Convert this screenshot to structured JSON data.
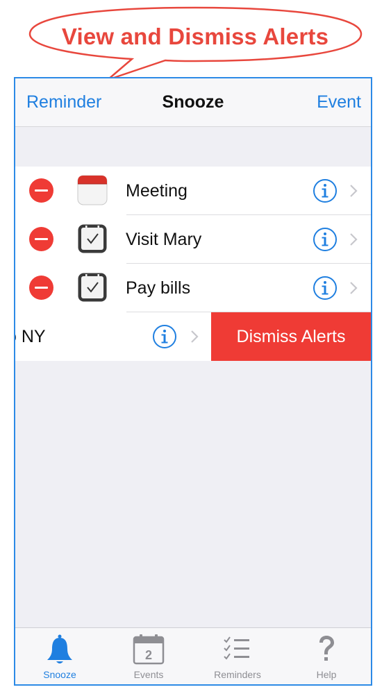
{
  "callout": {
    "text": "View and Dismiss Alerts"
  },
  "navbar": {
    "left_label": "Reminder",
    "title": "Snooze",
    "right_label": "Event"
  },
  "list": {
    "items": [
      {
        "label": "Meeting",
        "icon": "calendar-icon"
      },
      {
        "label": "Visit Mary",
        "icon": "checkbox-icon"
      },
      {
        "label": "Pay bills",
        "icon": "checkbox-icon"
      }
    ],
    "swiped_item": {
      "label": "o NY",
      "action_label": "Dismiss Alerts"
    }
  },
  "tabbar": {
    "tabs": [
      {
        "label": "Snooze",
        "icon": "bell-icon",
        "active": true
      },
      {
        "label": "Events",
        "icon": "calendar-icon",
        "badge_day": "2"
      },
      {
        "label": "Reminders",
        "icon": "checklist-icon"
      },
      {
        "label": "Help",
        "icon": "question-mark-icon"
      }
    ]
  },
  "colors": {
    "accent": "#1f7fe0",
    "destructive": "#ef3b35",
    "callout": "#e8473d"
  }
}
